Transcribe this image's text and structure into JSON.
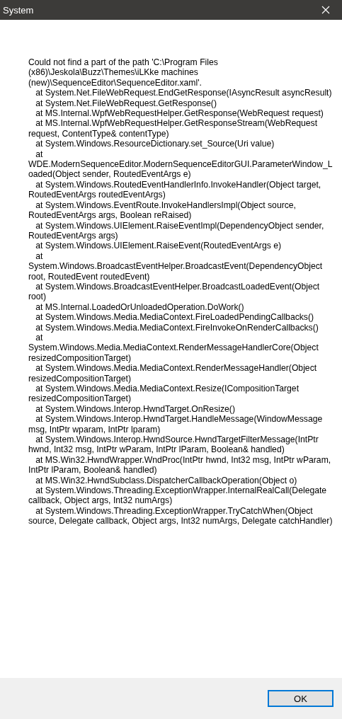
{
  "window": {
    "title": "System"
  },
  "message": "Could not find a part of the path 'C:\\Program Files (x86)\\Jeskola\\Buzz\\Themes\\iLKke machines (new)\\SequenceEditor\\SequenceEditor.xaml'.\n   at System.Net.FileWebRequest.EndGetResponse(IAsyncResult asyncResult)\n   at System.Net.FileWebRequest.GetResponse()\n   at MS.Internal.WpfWebRequestHelper.GetResponse(WebRequest request)\n   at MS.Internal.WpfWebRequestHelper.GetResponseStream(WebRequest request, ContentType& contentType)\n   at System.Windows.ResourceDictionary.set_Source(Uri value)\n   at WDE.ModernSequenceEditor.ModernSequenceEditorGUI.ParameterWindow_Loaded(Object sender, RoutedEventArgs e)\n   at System.Windows.RoutedEventHandlerInfo.InvokeHandler(Object target, RoutedEventArgs routedEventArgs)\n   at System.Windows.EventRoute.InvokeHandlersImpl(Object source, RoutedEventArgs args, Boolean reRaised)\n   at System.Windows.UIElement.RaiseEventImpl(DependencyObject sender, RoutedEventArgs args)\n   at System.Windows.UIElement.RaiseEvent(RoutedEventArgs e)\n   at System.Windows.BroadcastEventHelper.BroadcastEvent(DependencyObject root, RoutedEvent routedEvent)\n   at System.Windows.BroadcastEventHelper.BroadcastLoadedEvent(Object root)\n   at MS.Internal.LoadedOrUnloadedOperation.DoWork()\n   at System.Windows.Media.MediaContext.FireLoadedPendingCallbacks()\n   at System.Windows.Media.MediaContext.FireInvokeOnRenderCallbacks()\n   at System.Windows.Media.MediaContext.RenderMessageHandlerCore(Object resizedCompositionTarget)\n   at System.Windows.Media.MediaContext.RenderMessageHandler(Object resizedCompositionTarget)\n   at System.Windows.Media.MediaContext.Resize(ICompositionTarget resizedCompositionTarget)\n   at System.Windows.Interop.HwndTarget.OnResize()\n   at System.Windows.Interop.HwndTarget.HandleMessage(WindowMessage msg, IntPtr wparam, IntPtr lparam)\n   at System.Windows.Interop.HwndSource.HwndTargetFilterMessage(IntPtr hwnd, Int32 msg, IntPtr wParam, IntPtr lParam, Boolean& handled)\n   at MS.Win32.HwndWrapper.WndProc(IntPtr hwnd, Int32 msg, IntPtr wParam, IntPtr lParam, Boolean& handled)\n   at MS.Win32.HwndSubclass.DispatcherCallbackOperation(Object o)\n   at System.Windows.Threading.ExceptionWrapper.InternalRealCall(Delegate callback, Object args, Int32 numArgs)\n   at System.Windows.Threading.ExceptionWrapper.TryCatchWhen(Object source, Delegate callback, Object args, Int32 numArgs, Delegate catchHandler)",
  "buttons": [
    "OK"
  ]
}
